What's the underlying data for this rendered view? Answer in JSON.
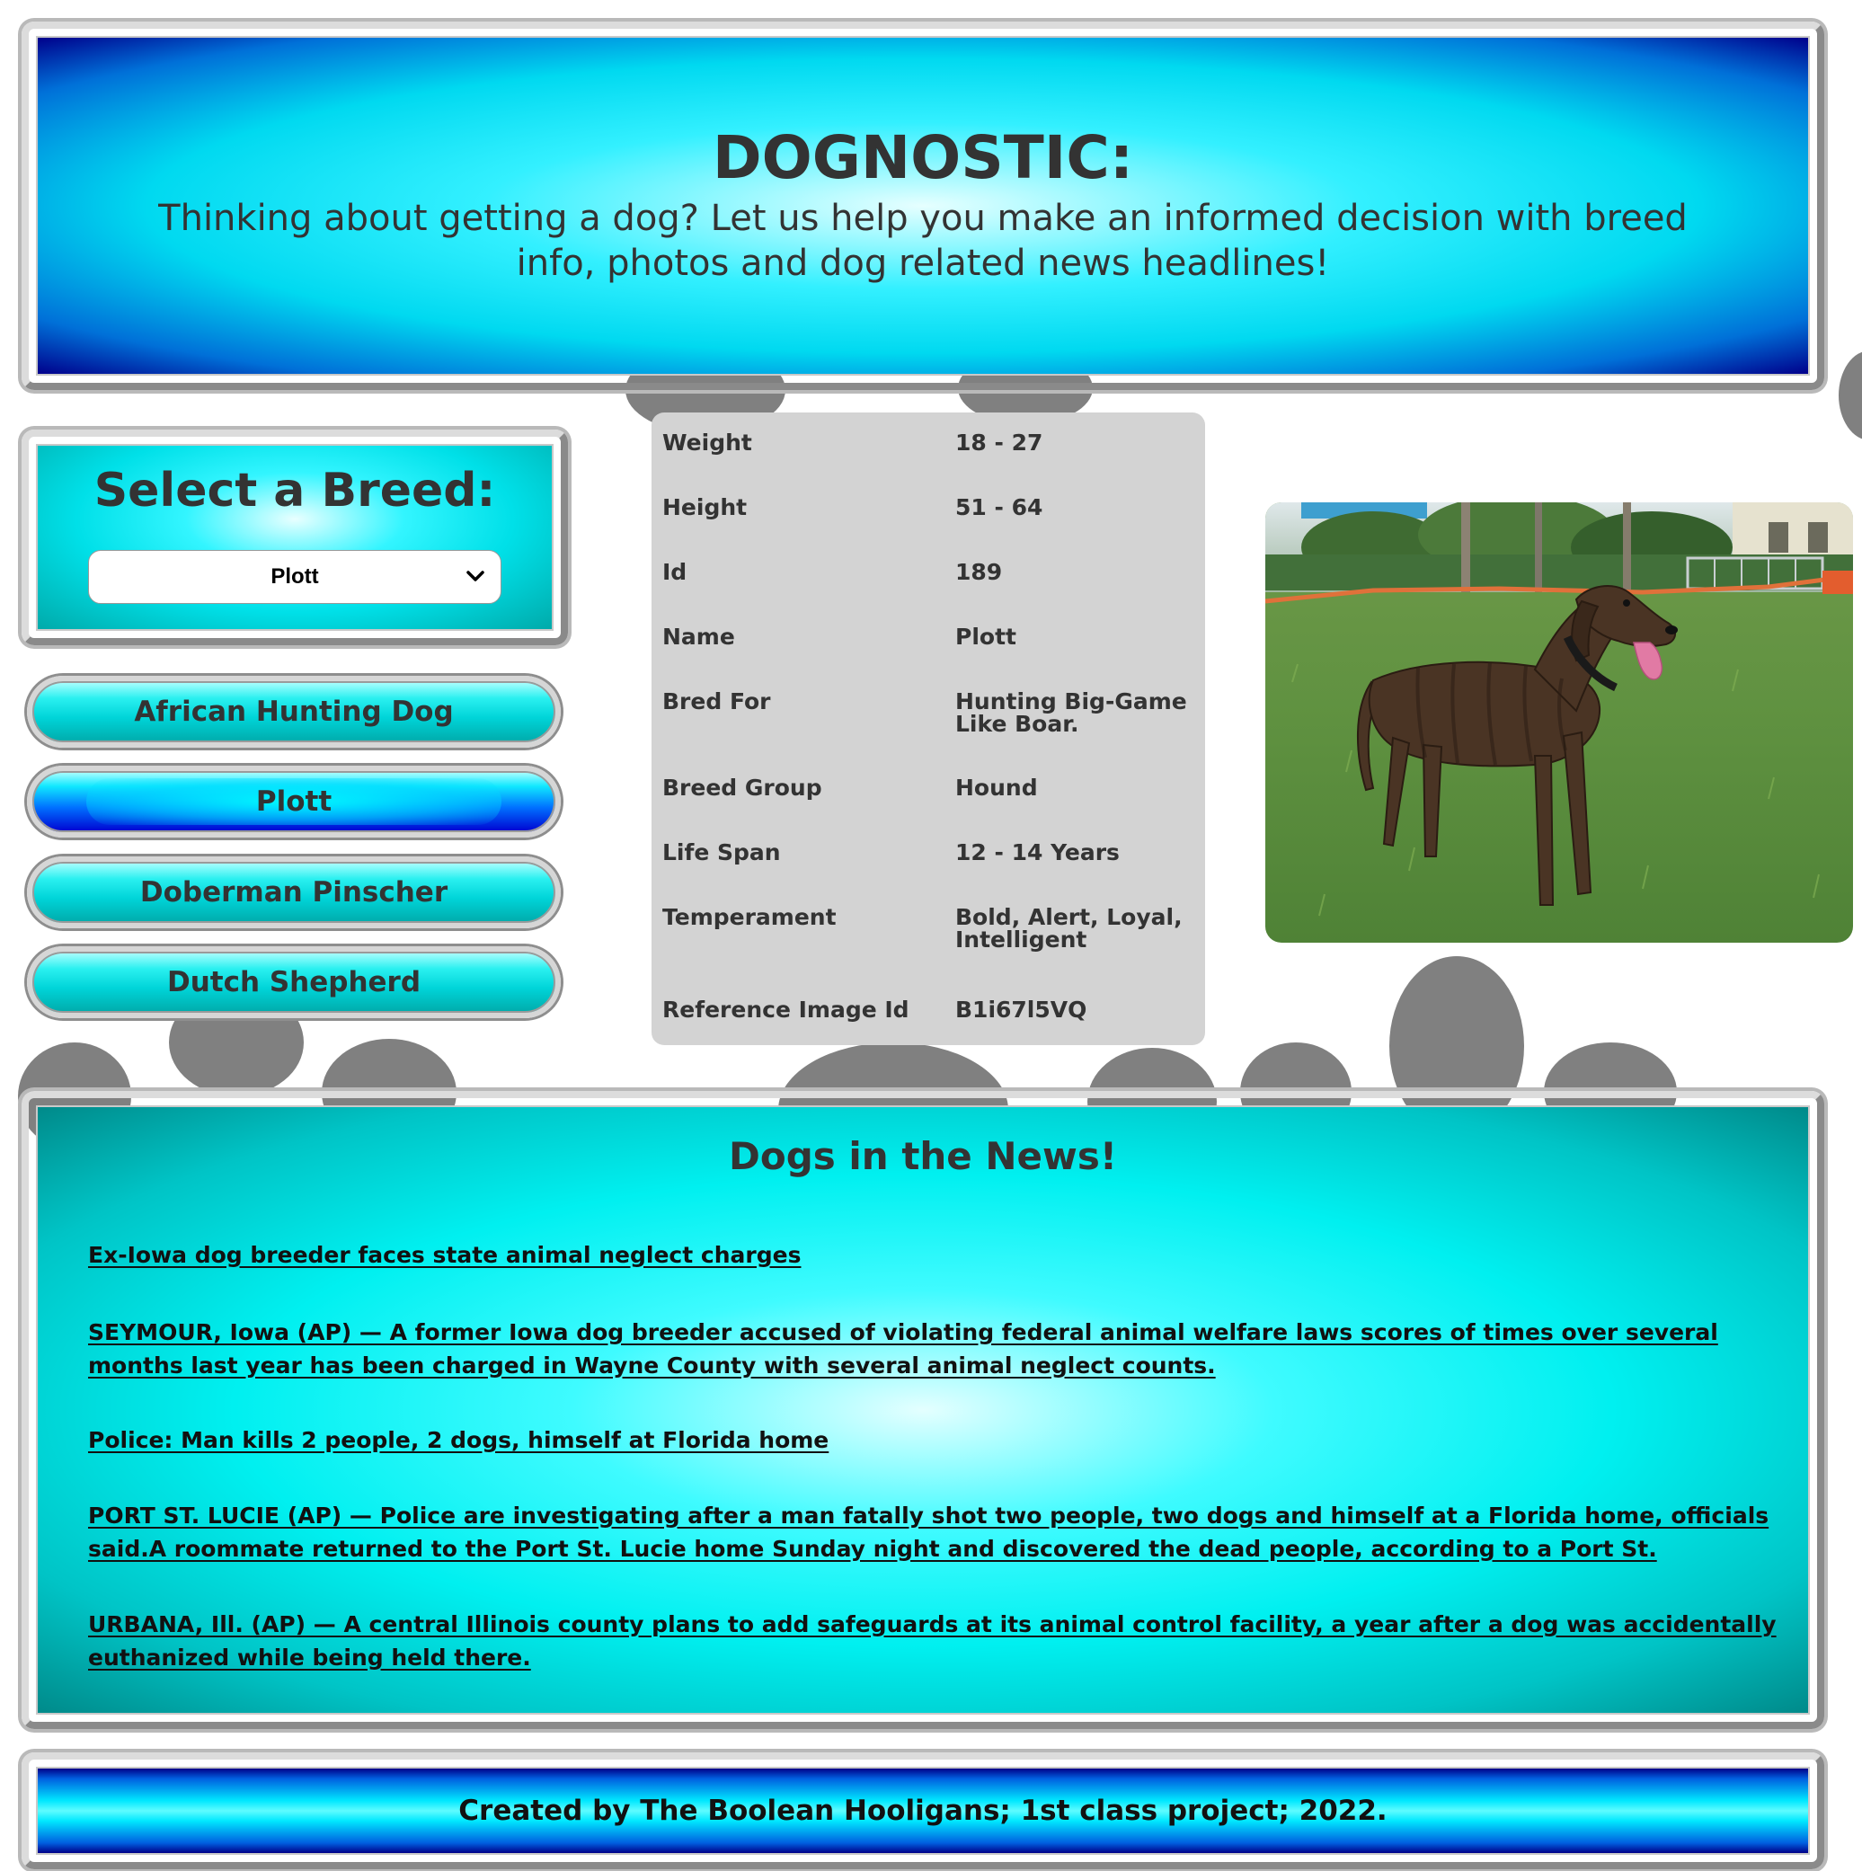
{
  "header": {
    "title": "DOGNOSTIC:",
    "tagline": "Thinking about getting a dog? Let us help you make an informed decision with breed info, photos and dog related news headlines!"
  },
  "breed_selector": {
    "title": "Select a Breed:",
    "selected_value": "Plott",
    "chevron_icon": "chevron-down-icon"
  },
  "breed_buttons": [
    {
      "label": "African Hunting Dog",
      "active": false
    },
    {
      "label": "Plott",
      "active": true
    },
    {
      "label": "Doberman Pinscher",
      "active": false
    },
    {
      "label": "Dutch Shepherd",
      "active": false
    }
  ],
  "breed_info": [
    {
      "key": "Weight",
      "value": "18 - 27"
    },
    {
      "key": "Height",
      "value": "51 - 64"
    },
    {
      "key": "Id",
      "value": "189"
    },
    {
      "key": "Name",
      "value": "Plott"
    },
    {
      "key": "Bred For",
      "value": "Hunting Big-Game Like Boar."
    },
    {
      "key": "Breed Group",
      "value": "Hound"
    },
    {
      "key": "Life Span",
      "value": "12 - 14 Years"
    },
    {
      "key": "Temperament",
      "value": "Bold, Alert, Loyal, Intelligent"
    },
    {
      "key": "Reference Image Id",
      "value": "B1i67l5VQ"
    }
  ],
  "news": {
    "title": "Dogs in the News!",
    "items": [
      "Ex-Iowa dog breeder faces state animal neglect charges",
      "SEYMOUR, Iowa (AP) — A former Iowa dog breeder accused of violating federal animal welfare laws scores of times over several months last year has been charged in Wayne County with several animal neglect counts.",
      "Police: Man kills 2 people, 2 dogs, himself at Florida home",
      "PORT ST. LUCIE (AP) — Police are investigating after a man fatally shot two people, two dogs and himself at a Florida home, officials said.A roommate returned to the Port St. Lucie home Sunday night and discovered the dead people, according to a Port St.",
      "URBANA, Ill. (AP) — A central Illinois county plans to add safeguards at its animal control facility, a year after a dog was accidentally euthanized while being held there."
    ]
  },
  "footer": {
    "text": "Created by The Boolean Hooligans; 1st class project; 2022."
  },
  "colors": {
    "accent_cyan": "#00f0f0",
    "accent_blue": "#0000d0",
    "table_bg": "#d3d3d3",
    "paw_gray": "#808080"
  }
}
